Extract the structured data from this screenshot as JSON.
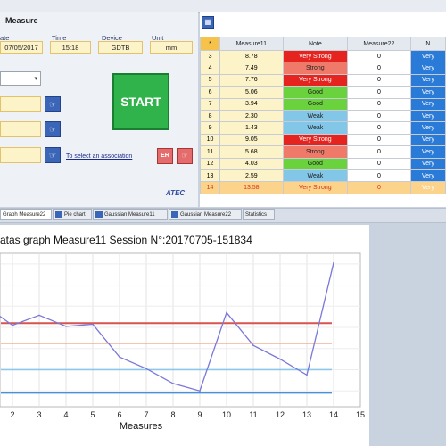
{
  "window": {
    "title": "Measure"
  },
  "session": {
    "headers": [
      "ate",
      "Time",
      "Device",
      "Unit"
    ],
    "values": [
      "07/05/2017",
      "15:18",
      "GDTB",
      "mm"
    ]
  },
  "start_label": "START",
  "association_link": "To select an association",
  "er_label": "ER",
  "logo_text": "ATEC",
  "table": {
    "columns": [
      "*",
      "Measure11",
      "Note",
      "Measure22",
      "N"
    ],
    "rows": [
      {
        "idx": "3",
        "m11": "8.78",
        "note": "Very Strong",
        "m22": "0",
        "n": "Very"
      },
      {
        "idx": "4",
        "m11": "7.49",
        "note": "Strong",
        "m22": "0",
        "n": "Very"
      },
      {
        "idx": "5",
        "m11": "7.76",
        "note": "Very Strong",
        "m22": "0",
        "n": "Very"
      },
      {
        "idx": "6",
        "m11": "5.06",
        "note": "Good",
        "m22": "0",
        "n": "Very"
      },
      {
        "idx": "7",
        "m11": "3.94",
        "note": "Good",
        "m22": "0",
        "n": "Very"
      },
      {
        "idx": "8",
        "m11": "2.30",
        "note": "Weak",
        "m22": "0",
        "n": "Very"
      },
      {
        "idx": "9",
        "m11": "1.43",
        "note": "Weak",
        "m22": "0",
        "n": "Very"
      },
      {
        "idx": "10",
        "m11": "9.05",
        "note": "Very Strong",
        "m22": "0",
        "n": "Very"
      },
      {
        "idx": "11",
        "m11": "5.68",
        "note": "Strong",
        "m22": "0",
        "n": "Very"
      },
      {
        "idx": "12",
        "m11": "4.03",
        "note": "Good",
        "m22": "0",
        "n": "Very"
      },
      {
        "idx": "13",
        "m11": "2.59",
        "note": "Weak",
        "m22": "0",
        "n": "Very"
      },
      {
        "idx": "14",
        "m11": "13.58",
        "note": "Very Strong",
        "m22": "0",
        "n": "Very"
      }
    ]
  },
  "tabs": [
    {
      "label": "Graph Measure22"
    },
    {
      "label": "Pie chart"
    },
    {
      "label": "Gaussian Measure11"
    },
    {
      "label": "Gaussian Measure22"
    },
    {
      "label": "Statistics"
    }
  ],
  "chart_data": {
    "type": "line",
    "title": "atas graph Measure11 Session N°:20170705-151834",
    "xlabel": "Measures",
    "ylabel": "",
    "x_ticks": [
      "2",
      "3",
      "4",
      "5",
      "6",
      "7",
      "8",
      "9",
      "10",
      "11",
      "12",
      "13",
      "14",
      "15"
    ],
    "xlim": [
      1,
      15
    ],
    "series": [
      {
        "x": [
          1,
          2,
          3,
          4,
          5,
          6,
          7,
          8,
          9,
          10,
          11,
          12,
          13,
          14
        ],
        "y": [
          8.0,
          6.2,
          7.15,
          6.1,
          6.3,
          3.2,
          2.1,
          0.7,
          0.0,
          7.4,
          4.3,
          3.0,
          1.5,
          12.1
        ]
      }
    ],
    "reference_lines": [
      {
        "y": 6.4,
        "color": "#d9534f"
      },
      {
        "y": 4.5,
        "color": "#f0a080"
      },
      {
        "y": 2.0,
        "color": "#8fc7ea"
      },
      {
        "y": -0.2,
        "color": "#4a90d9"
      }
    ],
    "ylim": [
      -1.5,
      13
    ],
    "grid": true
  },
  "colors": {
    "very_strong": "#e52420",
    "strong": "#f07a6a",
    "good": "#6ad23c",
    "weak": "#82c6e8",
    "start_button": "#2fb34a"
  }
}
